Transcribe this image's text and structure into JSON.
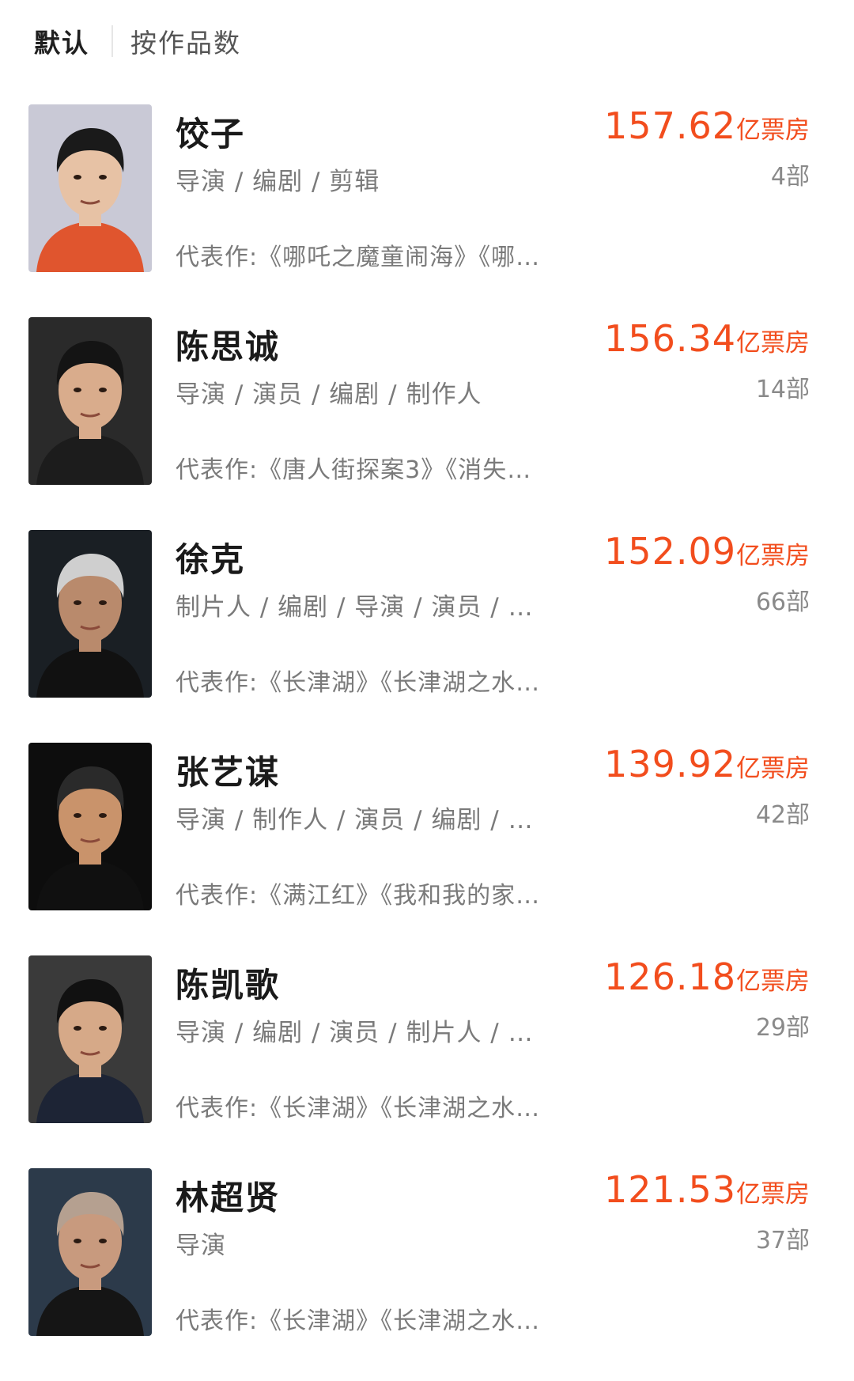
{
  "sort_tabs": {
    "default_label": "默认",
    "by_works_label": "按作品数"
  },
  "people": [
    {
      "name": "饺子",
      "roles": "导演 / 编剧 / 剪辑",
      "works": "代表作:《哪吒之魔童闹海》《哪…",
      "box_value": "157.62",
      "box_unit": "亿票房",
      "count": "4部",
      "avatar": {
        "bg": "#c9c9d6",
        "shirt": "#e0552e",
        "hair": "#1a1a1a",
        "skin": "#e7c2a5"
      }
    },
    {
      "name": "陈思诚",
      "roles": "导演 / 演员 / 编剧 / 制作人",
      "works": "代表作:《唐人街探案3》《消失…",
      "box_value": "156.34",
      "box_unit": "亿票房",
      "count": "14部",
      "avatar": {
        "bg": "#2a2a2a",
        "shirt": "#1c1c1c",
        "hair": "#141414",
        "skin": "#d9ac8c"
      }
    },
    {
      "name": "徐克",
      "roles": "制片人 / 编剧 / 导演 / 演员 / …",
      "works": "代表作:《长津湖》《长津湖之水…",
      "box_value": "152.09",
      "box_unit": "亿票房",
      "count": "66部",
      "avatar": {
        "bg": "#1a1f24",
        "shirt": "#111111",
        "hair": "#cfcfcf",
        "skin": "#b98a6c"
      }
    },
    {
      "name": "张艺谋",
      "roles": "导演 / 制作人 / 演员 / 编剧 / …",
      "works": "代表作:《满江红》《我和我的家…",
      "box_value": "139.92",
      "box_unit": "亿票房",
      "count": "42部",
      "avatar": {
        "bg": "#0d0d0d",
        "shirt": "#101010",
        "hair": "#2a2a2a",
        "skin": "#c9936b"
      }
    },
    {
      "name": "陈凯歌",
      "roles": "导演 / 编剧 / 演员 / 制片人 / …",
      "works": "代表作:《长津湖》《长津湖之水…",
      "box_value": "126.18",
      "box_unit": "亿票房",
      "count": "29部",
      "avatar": {
        "bg": "#3a3a3a",
        "shirt": "#1d2435",
        "hair": "#111111",
        "skin": "#d6a988"
      }
    },
    {
      "name": "林超贤",
      "roles": "导演",
      "works": "代表作:《长津湖》《长津湖之水…",
      "box_value": "121.53",
      "box_unit": "亿票房",
      "count": "37部",
      "avatar": {
        "bg": "#2c3a4a",
        "shirt": "#151515",
        "hair": "#b5a090",
        "skin": "#c89a7e"
      }
    }
  ]
}
